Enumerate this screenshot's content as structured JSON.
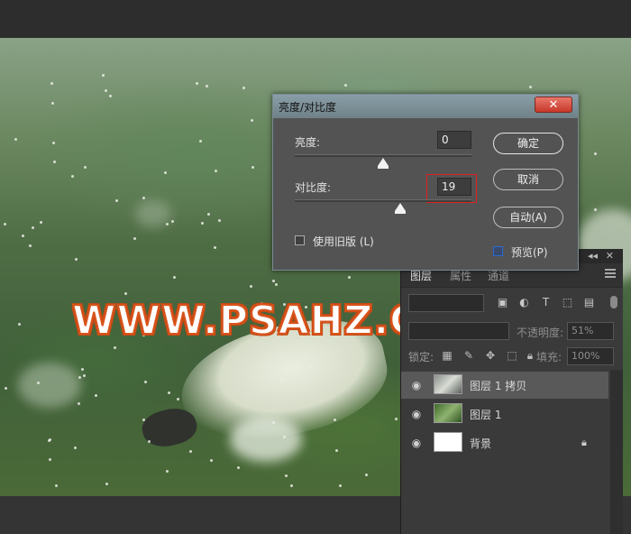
{
  "watermark": {
    "text": "WWW.PSAHZ.COM"
  },
  "dialog": {
    "title": "亮度/对比度",
    "close_symbol": "✕",
    "brightness": {
      "label": "亮度:",
      "value": "0",
      "level_percent": 50
    },
    "contrast": {
      "label": "对比度:",
      "value": "19",
      "level_percent": 59.5
    },
    "use_legacy": {
      "label": "使用旧版 (L)",
      "checked": false
    },
    "preview": {
      "label": "预览(P)",
      "checked": true
    },
    "buttons": {
      "ok": "确定",
      "cancel": "取消",
      "auto": "自动(A)"
    }
  },
  "layers_panel": {
    "collapse_symbol": "◂◂",
    "close_symbol": "✕",
    "tabs": [
      "图层",
      "属性",
      "通道"
    ],
    "opacity_label": "不透明度:",
    "opacity_value": "51%",
    "lock_label": "锁定:",
    "fill_label": "填充:",
    "fill_value": "100%",
    "layers": [
      {
        "name": "图层 1 拷贝",
        "visible": true,
        "selected": true,
        "thumb": "photo-gray"
      },
      {
        "name": "图层 1",
        "visible": true,
        "selected": false,
        "thumb": "photo-green"
      },
      {
        "name": "背景",
        "visible": true,
        "selected": false,
        "thumb": "white",
        "locked": true
      }
    ]
  },
  "colors": {
    "accent_red": "#e02020",
    "watermark_stroke": "#d8541c",
    "panel_bg": "#3a3a3a",
    "dialog_bg": "#535353"
  }
}
